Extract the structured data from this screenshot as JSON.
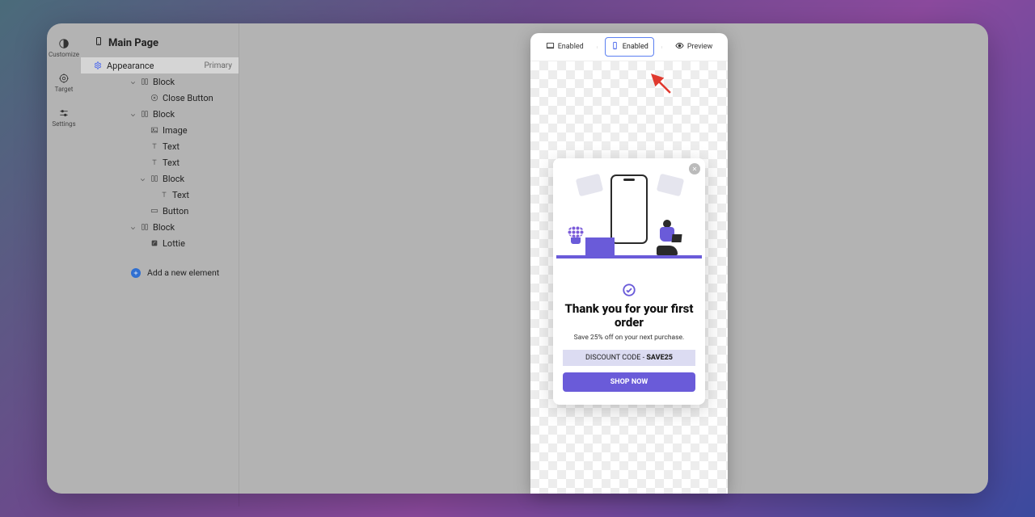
{
  "rail": {
    "items": [
      {
        "label": "Customize"
      },
      {
        "label": "Target"
      },
      {
        "label": "Settings"
      }
    ]
  },
  "sidebar": {
    "page_icon": "mobile",
    "page_title": "Main Page",
    "appearance": {
      "label": "Appearance",
      "badge": "Primary"
    },
    "tree": [
      {
        "indent": 0,
        "type": "block",
        "label": "Block",
        "chev": true,
        "icon": "columns"
      },
      {
        "indent": 1,
        "type": "item",
        "label": "Close Button",
        "icon": "close-circle"
      },
      {
        "indent": 0,
        "type": "block",
        "label": "Block",
        "chev": true,
        "icon": "columns"
      },
      {
        "indent": 1,
        "type": "item",
        "label": "Image",
        "icon": "image"
      },
      {
        "indent": 1,
        "type": "item",
        "label": "Text",
        "icon": "text"
      },
      {
        "indent": 1,
        "type": "item",
        "label": "Text",
        "icon": "text"
      },
      {
        "indent": 1,
        "type": "block",
        "label": "Block",
        "chev": true,
        "icon": "columns"
      },
      {
        "indent": 2,
        "type": "item",
        "label": "Text",
        "icon": "text"
      },
      {
        "indent": 1,
        "type": "item",
        "label": "Button",
        "icon": "button"
      },
      {
        "indent": 0,
        "type": "block",
        "label": "Block",
        "chev": true,
        "icon": "columns"
      },
      {
        "indent": 1,
        "type": "item",
        "label": "Lottie",
        "icon": "lottie"
      }
    ],
    "add_label": "Add a new element"
  },
  "toolbar": {
    "desktop": {
      "label": "Enabled"
    },
    "mobile": {
      "label": "Enabled"
    },
    "preview": {
      "label": "Preview"
    }
  },
  "popup": {
    "headline": "Thank you for your first order",
    "subline": "Save 25% off on your next purchase.",
    "coupon_prefix": "DISCOUNT CODE - ",
    "coupon_code": "SAVE25",
    "cta": "SHOP NOW"
  }
}
